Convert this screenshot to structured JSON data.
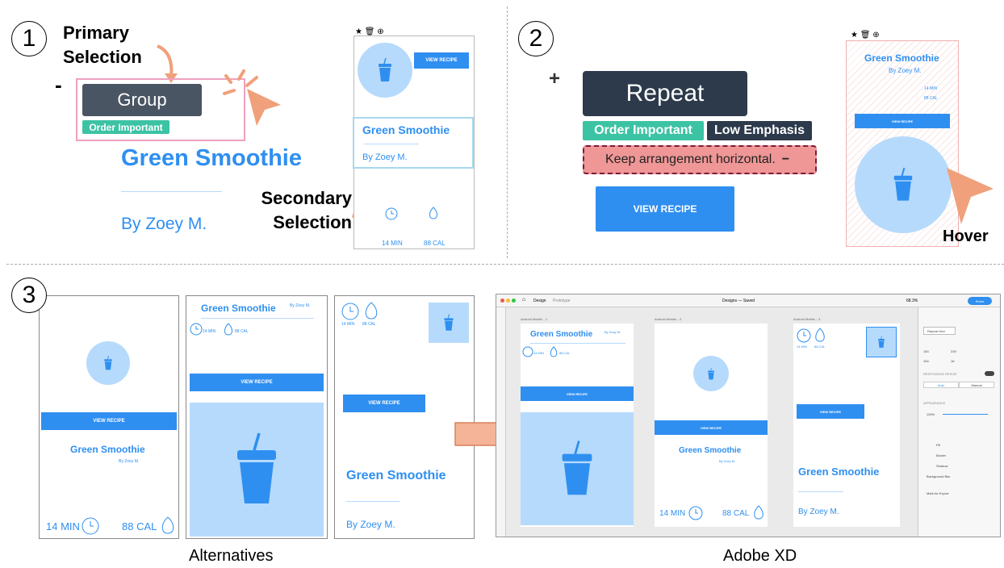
{
  "panel1": {
    "step": "1",
    "primary_label_line1": "Primary",
    "primary_label_line2": "Selection",
    "minus": "-",
    "group": "Group",
    "tag": "Order Important",
    "title": "Green Smoothie",
    "author": "By Zoey M.",
    "secondary_label_line1": "Secondary",
    "secondary_label_line2": "Selection",
    "button": "VIEW RECIPE",
    "title_small": "Green Smoothie",
    "author_small": "By Zoey M.",
    "time": "14 MIN",
    "cal": "88 CAL",
    "toolbar": "★ 🗑 ⊕"
  },
  "panel2": {
    "step": "2",
    "plus": "+",
    "repeat": "Repeat",
    "tag1": "Order Important",
    "tag2": "Low Emphasis",
    "constraint": "Keep arrangement horizontal.",
    "constraint_minus": "−",
    "button": "VIEW RECIPE",
    "title": "Green Smoothie",
    "author": "By Zoey M.",
    "time": "14 MIN",
    "cal": "88 CAL",
    "hover": "Hover",
    "toolbar": "★ 🗑 ⊕"
  },
  "panel3": {
    "step": "3",
    "caption_left": "Alternatives",
    "caption_right": "Adobe XD",
    "alts": [
      {
        "button": "VIEW RECIPE",
        "title": "Green Smoothie",
        "author": "By Zoey M.",
        "time": "14 MIN",
        "cal": "88 CAL"
      },
      {
        "title": "Green Smoothie",
        "author": "By Zoey M.",
        "time": "14 MIN",
        "cal": "88 CAL",
        "button": "VIEW RECIPE"
      },
      {
        "time": "14 MIN",
        "cal": "88 CAL",
        "button": "VIEW RECIPE",
        "title": "Green Smoothie",
        "author": "By Zoey M."
      }
    ],
    "xd": {
      "tab_design": "Design",
      "tab_prototype": "Prototype",
      "doc": "Designs — Saved",
      "zoom": "68.3%",
      "share": "Share",
      "artboards": [
        "Android Mobile – 1",
        "Android Mobile – 2",
        "Android Mobile – 3"
      ],
      "repeat_grid": "Repeat Grid",
      "w": "154",
      "x": "154",
      "h": "239",
      "y": "16",
      "responsive": "RESPONSIVE RESIZE",
      "auto": "Auto",
      "manual": "Manual",
      "appearance": "APPEARANCE",
      "opacity": "100%",
      "fill": "Fill",
      "border": "Border",
      "shadow": "Shadow",
      "blur": "Background Blur",
      "export": "Mark for Export"
    }
  }
}
